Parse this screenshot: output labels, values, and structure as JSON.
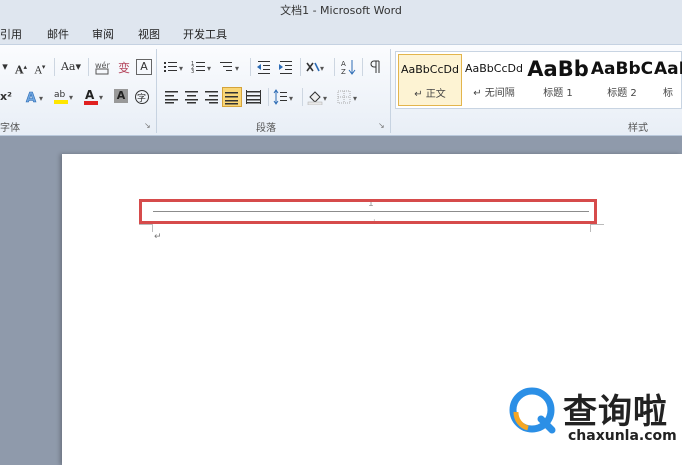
{
  "window": {
    "title": "文档1 - Microsoft Word"
  },
  "ribbon_tabs": [
    "引用",
    "邮件",
    "审阅",
    "视图",
    "开发工具"
  ],
  "groups": {
    "font": "字体",
    "paragraph": "段落",
    "styles": "样式"
  },
  "font_buttons": {
    "grow": "A",
    "shrink": "A",
    "case": "Aa",
    "clear": "A",
    "char_border": "A",
    "highlight": "ab",
    "font_color": "A",
    "char_shading": "A",
    "enclose": "字"
  },
  "styles": [
    {
      "preview": "AaBbCcDd",
      "name": "↵ 正文",
      "selected": true
    },
    {
      "preview": "AaBbCcDd",
      "name": "↵ 无间隔",
      "selected": false
    },
    {
      "preview": "AaBb",
      "name": "标题 1",
      "selected": false
    },
    {
      "preview": "AaBbC",
      "name": "标题 2",
      "selected": false
    },
    {
      "preview": "AaB",
      "name": "标",
      "selected": false
    }
  ],
  "document": {
    "page_number": "1",
    "paragraph_mark": "↵"
  },
  "watermark": {
    "brand": "查询啦",
    "url": "chaxunla.com",
    "logo_color": "#2b8fe6"
  }
}
